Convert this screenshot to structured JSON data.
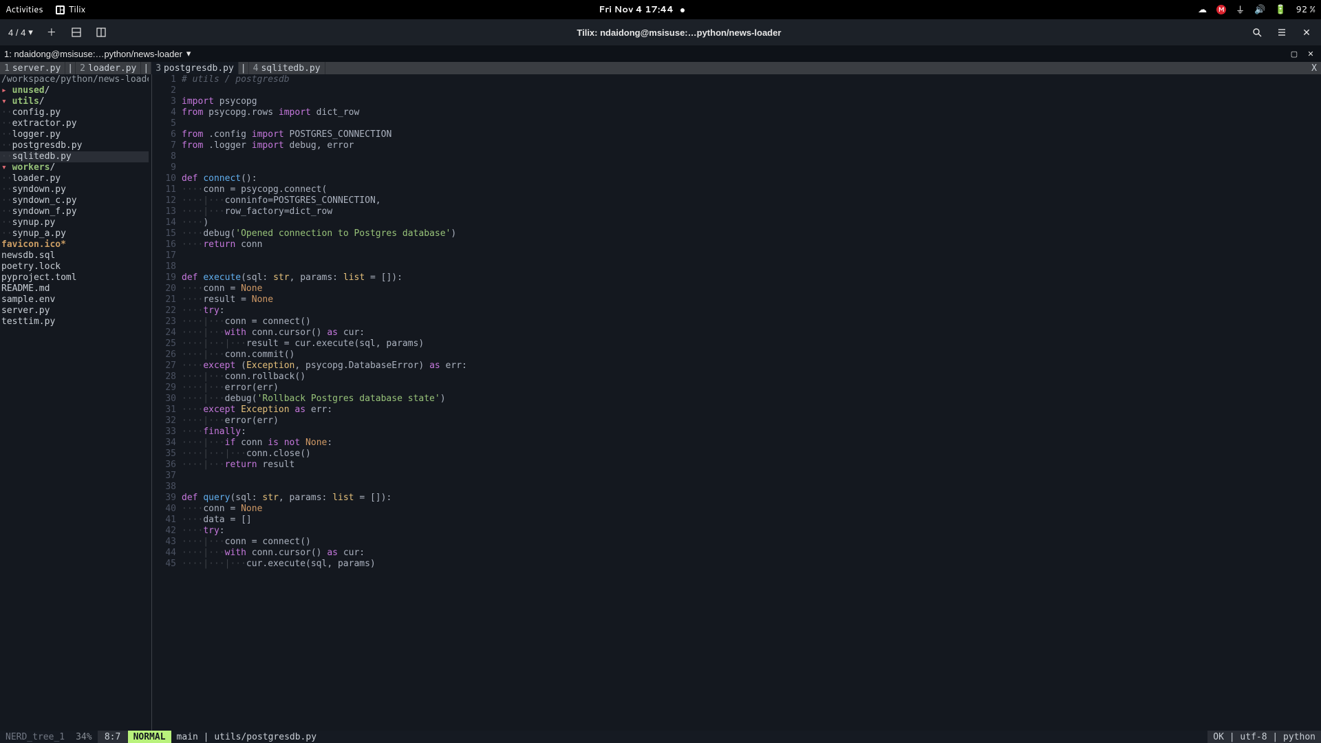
{
  "gnome_bar": {
    "activities": "Activities",
    "app_name": "Tilix",
    "clock": "Fri Nov 4  17:44",
    "battery": "92 %"
  },
  "tilix": {
    "session_indicator": "4 / 4",
    "title": "Tilix: ndaidong@msisuse:…python/news-loader",
    "terminal_title": "1: ndaidong@msisuse:…python/news-loader"
  },
  "tabs": [
    {
      "num": "1",
      "label": "server.py"
    },
    {
      "num": "2",
      "label": "loader.py"
    },
    {
      "num": "3",
      "label": "postgresdb.py",
      "active": true
    },
    {
      "num": "4",
      "label": "sqlitedb.py"
    }
  ],
  "tree": {
    "root": "/workspace/python/news-loader/",
    "items": [
      {
        "type": "dir",
        "arrow": "▸",
        "name": "unused",
        "suffix": "/"
      },
      {
        "type": "dir",
        "arrow": "▾",
        "name": "utils",
        "suffix": "/"
      },
      {
        "type": "file",
        "indent": 1,
        "name": "config.py"
      },
      {
        "type": "file",
        "indent": 1,
        "name": "extractor.py"
      },
      {
        "type": "file",
        "indent": 1,
        "name": "logger.py"
      },
      {
        "type": "file",
        "indent": 1,
        "name": "postgresdb.py"
      },
      {
        "type": "file",
        "indent": 1,
        "name": "sqlitedb.py",
        "selected": true
      },
      {
        "type": "dir",
        "arrow": "▾",
        "name": "workers",
        "suffix": "/"
      },
      {
        "type": "file",
        "indent": 1,
        "name": "loader.py"
      },
      {
        "type": "file",
        "indent": 1,
        "name": "syndown.py"
      },
      {
        "type": "file",
        "indent": 1,
        "name": "syndown_c.py"
      },
      {
        "type": "file",
        "indent": 1,
        "name": "syndown_f.py"
      },
      {
        "type": "file",
        "indent": 1,
        "name": "synup.py"
      },
      {
        "type": "file",
        "indent": 1,
        "name": "synup_a.py"
      },
      {
        "type": "special",
        "indent": 0,
        "name": "favicon.ico*"
      },
      {
        "type": "file",
        "indent": 0,
        "name": "newsdb.sql"
      },
      {
        "type": "file",
        "indent": 0,
        "name": "poetry.lock"
      },
      {
        "type": "file",
        "indent": 0,
        "name": "pyproject.toml"
      },
      {
        "type": "file",
        "indent": 0,
        "name": "README.md"
      },
      {
        "type": "file",
        "indent": 0,
        "name": "sample.env"
      },
      {
        "type": "file",
        "indent": 0,
        "name": "server.py"
      },
      {
        "type": "file",
        "indent": 0,
        "name": "testtim.py"
      }
    ]
  },
  "status": {
    "tree_label": "NERD_tree_1",
    "percent": "34%",
    "position": "8:7",
    "mode": "NORMAL",
    "branch_file": "main | utils/postgresdb.py",
    "right": "OK | utf-8 | python"
  },
  "code": [
    {
      "n": 1,
      "seg": [
        [
          "c-comment",
          "# utils / postgresdb"
        ]
      ]
    },
    {
      "n": 2,
      "seg": []
    },
    {
      "n": 3,
      "seg": [
        [
          "c-import",
          "import"
        ],
        [
          "c-op",
          " psycopg"
        ]
      ]
    },
    {
      "n": 4,
      "seg": [
        [
          "c-import",
          "from"
        ],
        [
          "c-op",
          " psycopg.rows "
        ],
        [
          "c-import",
          "import"
        ],
        [
          "c-op",
          " dict_row"
        ]
      ]
    },
    {
      "n": 5,
      "seg": []
    },
    {
      "n": 6,
      "seg": [
        [
          "c-import",
          "from"
        ],
        [
          "c-op",
          " .config "
        ],
        [
          "c-import",
          "import"
        ],
        [
          "c-op",
          " POSTGRES_CONNECTION"
        ]
      ]
    },
    {
      "n": 7,
      "seg": [
        [
          "c-import",
          "from"
        ],
        [
          "c-op",
          " .logger "
        ],
        [
          "c-import",
          "import"
        ],
        [
          "c-op",
          " debug, error"
        ]
      ]
    },
    {
      "n": 8,
      "seg": []
    },
    {
      "n": 9,
      "seg": []
    },
    {
      "n": 10,
      "seg": [
        [
          "c-keyword",
          "def"
        ],
        [
          "c-op",
          " "
        ],
        [
          "c-func",
          "connect"
        ],
        [
          "c-paren",
          "():"
        ]
      ]
    },
    {
      "n": 11,
      "seg": [
        [
          "c-indent",
          "····"
        ],
        [
          "c-op",
          "conn = psycopg.connect("
        ]
      ]
    },
    {
      "n": 12,
      "seg": [
        [
          "c-indent",
          "····|···"
        ],
        [
          "c-op",
          "conninfo=POSTGRES_CONNECTION,"
        ]
      ]
    },
    {
      "n": 13,
      "seg": [
        [
          "c-indent",
          "····|···"
        ],
        [
          "c-op",
          "row_factory=dict_row"
        ]
      ]
    },
    {
      "n": 14,
      "seg": [
        [
          "c-indent",
          "····"
        ],
        [
          "c-op",
          ")"
        ]
      ]
    },
    {
      "n": 15,
      "seg": [
        [
          "c-indent",
          "····"
        ],
        [
          "c-op",
          "debug("
        ],
        [
          "c-str",
          "'Opened connection to Postgres database'"
        ],
        [
          "c-op",
          ")"
        ]
      ]
    },
    {
      "n": 16,
      "seg": [
        [
          "c-indent",
          "····"
        ],
        [
          "c-keyword",
          "return"
        ],
        [
          "c-op",
          " conn"
        ]
      ]
    },
    {
      "n": 17,
      "seg": []
    },
    {
      "n": 18,
      "seg": []
    },
    {
      "n": 19,
      "seg": [
        [
          "c-keyword",
          "def"
        ],
        [
          "c-op",
          " "
        ],
        [
          "c-func",
          "execute"
        ],
        [
          "c-paren",
          "(sql: "
        ],
        [
          "c-type",
          "str"
        ],
        [
          "c-paren",
          ", params: "
        ],
        [
          "c-type",
          "list"
        ],
        [
          "c-paren",
          " = []):"
        ]
      ]
    },
    {
      "n": 20,
      "seg": [
        [
          "c-indent",
          "····"
        ],
        [
          "c-op",
          "conn = "
        ],
        [
          "c-none",
          "None"
        ]
      ]
    },
    {
      "n": 21,
      "seg": [
        [
          "c-indent",
          "····"
        ],
        [
          "c-op",
          "result = "
        ],
        [
          "c-none",
          "None"
        ]
      ]
    },
    {
      "n": 22,
      "seg": [
        [
          "c-indent",
          "····"
        ],
        [
          "c-keyword",
          "try"
        ],
        [
          "c-op",
          ":"
        ]
      ]
    },
    {
      "n": 23,
      "seg": [
        [
          "c-indent",
          "····|···"
        ],
        [
          "c-op",
          "conn = connect()"
        ]
      ]
    },
    {
      "n": 24,
      "seg": [
        [
          "c-indent",
          "····|···"
        ],
        [
          "c-keyword",
          "with"
        ],
        [
          "c-op",
          " conn.cursor() "
        ],
        [
          "c-keyword",
          "as"
        ],
        [
          "c-op",
          " cur:"
        ]
      ]
    },
    {
      "n": 25,
      "seg": [
        [
          "c-indent",
          "····|···|···"
        ],
        [
          "c-op",
          "result = cur.execute(sql, params)"
        ]
      ]
    },
    {
      "n": 26,
      "seg": [
        [
          "c-indent",
          "····|···"
        ],
        [
          "c-op",
          "conn.commit()"
        ]
      ]
    },
    {
      "n": 27,
      "seg": [
        [
          "c-indent",
          "····"
        ],
        [
          "c-keyword",
          "except"
        ],
        [
          "c-op",
          " ("
        ],
        [
          "c-type",
          "Exception"
        ],
        [
          "c-op",
          ", psycopg.DatabaseError) "
        ],
        [
          "c-keyword",
          "as"
        ],
        [
          "c-op",
          " err:"
        ]
      ]
    },
    {
      "n": 28,
      "seg": [
        [
          "c-indent",
          "····|···"
        ],
        [
          "c-op",
          "conn.rollback()"
        ]
      ]
    },
    {
      "n": 29,
      "seg": [
        [
          "c-indent",
          "····|···"
        ],
        [
          "c-op",
          "error(err)"
        ]
      ]
    },
    {
      "n": 30,
      "seg": [
        [
          "c-indent",
          "····|···"
        ],
        [
          "c-op",
          "debug("
        ],
        [
          "c-str",
          "'Rollback Postgres database state'"
        ],
        [
          "c-op",
          ")"
        ]
      ]
    },
    {
      "n": 31,
      "seg": [
        [
          "c-indent",
          "····"
        ],
        [
          "c-keyword",
          "except"
        ],
        [
          "c-op",
          " "
        ],
        [
          "c-type",
          "Exception"
        ],
        [
          "c-op",
          " "
        ],
        [
          "c-keyword",
          "as"
        ],
        [
          "c-op",
          " err:"
        ]
      ]
    },
    {
      "n": 32,
      "seg": [
        [
          "c-indent",
          "····|···"
        ],
        [
          "c-op",
          "error(err)"
        ]
      ]
    },
    {
      "n": 33,
      "seg": [
        [
          "c-indent",
          "····"
        ],
        [
          "c-keyword",
          "finally"
        ],
        [
          "c-op",
          ":"
        ]
      ]
    },
    {
      "n": 34,
      "seg": [
        [
          "c-indent",
          "····|···"
        ],
        [
          "c-keyword",
          "if"
        ],
        [
          "c-op",
          " conn "
        ],
        [
          "c-keyword",
          "is"
        ],
        [
          "c-op",
          " "
        ],
        [
          "c-keyword",
          "not"
        ],
        [
          "c-op",
          " "
        ],
        [
          "c-none",
          "None"
        ],
        [
          "c-op",
          ":"
        ]
      ]
    },
    {
      "n": 35,
      "seg": [
        [
          "c-indent",
          "····|···|···"
        ],
        [
          "c-op",
          "conn.close()"
        ]
      ]
    },
    {
      "n": 36,
      "seg": [
        [
          "c-indent",
          "····|···"
        ],
        [
          "c-keyword",
          "return"
        ],
        [
          "c-op",
          " result"
        ]
      ]
    },
    {
      "n": 37,
      "seg": []
    },
    {
      "n": 38,
      "seg": []
    },
    {
      "n": 39,
      "seg": [
        [
          "c-keyword",
          "def"
        ],
        [
          "c-op",
          " "
        ],
        [
          "c-func",
          "query"
        ],
        [
          "c-paren",
          "(sql: "
        ],
        [
          "c-type",
          "str"
        ],
        [
          "c-paren",
          ", params: "
        ],
        [
          "c-type",
          "list"
        ],
        [
          "c-paren",
          " = []):"
        ]
      ]
    },
    {
      "n": 40,
      "seg": [
        [
          "c-indent",
          "····"
        ],
        [
          "c-op",
          "conn = "
        ],
        [
          "c-none",
          "None"
        ]
      ]
    },
    {
      "n": 41,
      "seg": [
        [
          "c-indent",
          "····"
        ],
        [
          "c-op",
          "data = []"
        ]
      ]
    },
    {
      "n": 42,
      "seg": [
        [
          "c-indent",
          "····"
        ],
        [
          "c-keyword",
          "try"
        ],
        [
          "c-op",
          ":"
        ]
      ]
    },
    {
      "n": 43,
      "seg": [
        [
          "c-indent",
          "····|···"
        ],
        [
          "c-op",
          "conn = connect()"
        ]
      ]
    },
    {
      "n": 44,
      "seg": [
        [
          "c-indent",
          "····|···"
        ],
        [
          "c-keyword",
          "with"
        ],
        [
          "c-op",
          " conn.cursor() "
        ],
        [
          "c-keyword",
          "as"
        ],
        [
          "c-op",
          " cur:"
        ]
      ]
    },
    {
      "n": 45,
      "seg": [
        [
          "c-indent",
          "····|···|···"
        ],
        [
          "c-op",
          "cur.execute(sql, params)"
        ]
      ]
    }
  ]
}
